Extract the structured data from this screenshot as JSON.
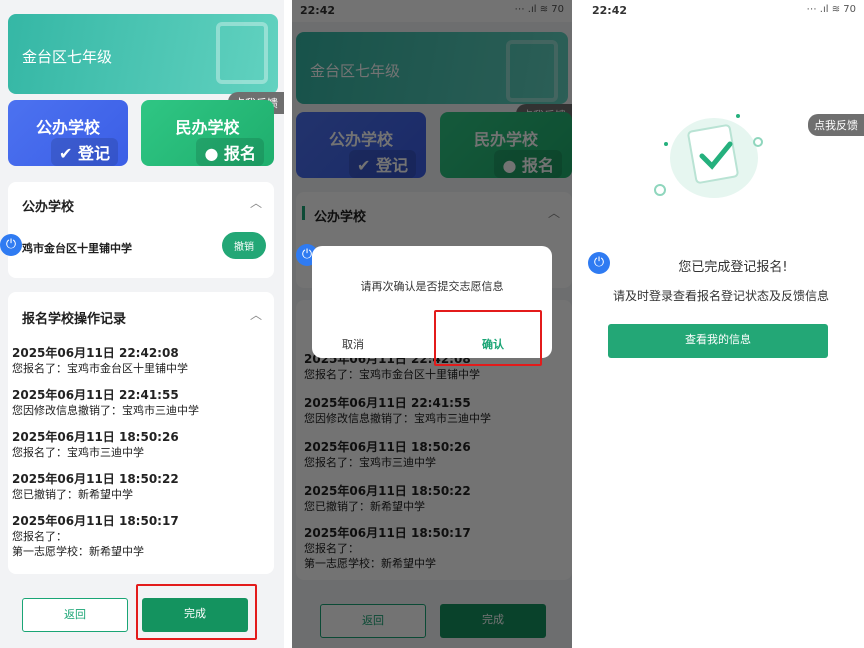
{
  "banner_title": "金台区七年级",
  "feedback_tag": "点我反馈",
  "school_cards": {
    "public": {
      "name": "公办学校",
      "action": "登记"
    },
    "private": {
      "name": "民办学校",
      "action": "报名"
    }
  },
  "public_section": {
    "title": "公办学校",
    "school": "鸡市金台区十里铺中学",
    "revoke_label": "撤销"
  },
  "records_section": {
    "title": "报名学校操作记录",
    "records": [
      {
        "time": "2025年06月11日 22:42:08",
        "lines": [
          "您报名了：宝鸡市金台区十里铺中学"
        ]
      },
      {
        "time": "2025年06月11日 22:41:55",
        "lines": [
          "您因修改信息撤销了：宝鸡市三迪中学"
        ]
      },
      {
        "time": "2025年06月11日 18:50:26",
        "lines": [
          "您报名了：宝鸡市三迪中学"
        ]
      },
      {
        "time": "2025年06月11日 18:50:22",
        "lines": [
          "您已撤销了：新希望中学"
        ]
      },
      {
        "time": "2025年06月11日 18:50:17",
        "lines": [
          "您报名了：",
          "第一志愿学校：新希望中学"
        ]
      }
    ]
  },
  "buttons": {
    "back": "返回",
    "done": "完成"
  },
  "status": {
    "time": "22:42",
    "icons": "⋯ .ıl ≋ 70"
  },
  "dialog": {
    "message": "请再次确认是否提交志愿信息",
    "cancel": "取消",
    "confirm": "确认"
  },
  "success": {
    "title": "您已完成登记报名!",
    "subtitle": "请及时登录查看报名登记状态及反馈信息",
    "view_button": "查看我的信息"
  },
  "colors": {
    "accent": "#1aa575",
    "highlight": "#e31b1b",
    "blue": "#2f7bf2"
  }
}
